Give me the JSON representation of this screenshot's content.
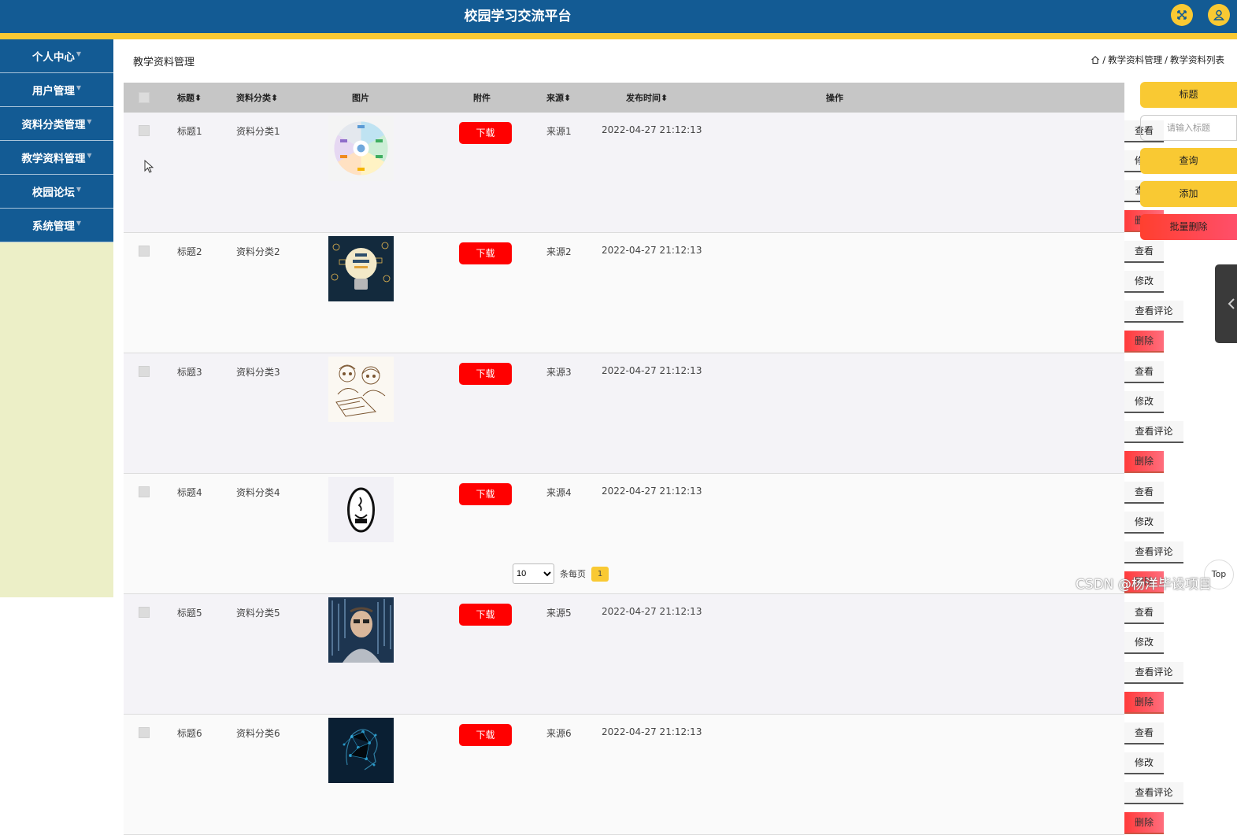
{
  "header": {
    "title": "校园学习交流平台",
    "fullscreen_icon": "expand-arrows-icon",
    "user_icon": "user-icon"
  },
  "colors": {
    "header_blue": "#135b94",
    "accent_yellow": "#f9c933",
    "download_red": "#ff0000",
    "sidebar_bg": "#ecefc7"
  },
  "sidebar": {
    "items": [
      {
        "label": "个人中心"
      },
      {
        "label": "用户管理"
      },
      {
        "label": "资料分类管理"
      },
      {
        "label": "教学资料管理"
      },
      {
        "label": "校园论坛"
      },
      {
        "label": "系统管理"
      }
    ]
  },
  "page": {
    "title": "教学资料管理",
    "breadcrumb": {
      "home_icon": "home-icon",
      "sep": "/",
      "level1": "教学资料管理",
      "level2": "教学资料列表"
    }
  },
  "table": {
    "headers": {
      "title": "标题",
      "category": "资料分类",
      "image": "图片",
      "attachment": "附件",
      "source": "来源",
      "time": "发布时间",
      "actions": "操作",
      "sort_glyph": "⬍"
    },
    "rows": [
      {
        "title": "标题1",
        "category": "资料分类1",
        "image": "java-topics-infographic",
        "download": "下载",
        "source": "来源1",
        "time": "2022-04-27 21:12:13"
      },
      {
        "title": "标题2",
        "category": "资料分类2",
        "image": "lightbulb-infographic",
        "download": "下载",
        "source": "来源2",
        "time": "2022-04-27 21:12:13"
      },
      {
        "title": "标题3",
        "category": "资料分类3",
        "image": "two-people-laptop-sketch",
        "download": "下载",
        "source": "来源3",
        "time": "2022-04-27 21:12:13"
      },
      {
        "title": "标题4",
        "category": "资料分类4",
        "image": "java-logo",
        "download": "下载",
        "source": "来源4",
        "time": "2022-04-27 21:12:13"
      },
      {
        "title": "标题5",
        "category": "资料分类5",
        "image": "man-code-matrix",
        "download": "下载",
        "source": "来源5",
        "time": "2022-04-27 21:12:13"
      },
      {
        "title": "标题6",
        "category": "资料分类6",
        "image": "ai-head-network",
        "download": "下载",
        "source": "来源6",
        "time": "2022-04-27 21:12:13"
      }
    ],
    "actions": {
      "view": "查看",
      "edit": "修改",
      "comments": "查看评论",
      "delete": "删除"
    }
  },
  "side_actions": {
    "title_label": "标题",
    "search_placeholder": "请输入标题",
    "query": "查询",
    "add": "添加",
    "batch_delete": "批量删除"
  },
  "pagination": {
    "page_size": "10",
    "per_page_label": "条每页",
    "current_page": "1"
  },
  "back_to_top": "Top",
  "watermark": "CSDN @杨洋毕设项目"
}
